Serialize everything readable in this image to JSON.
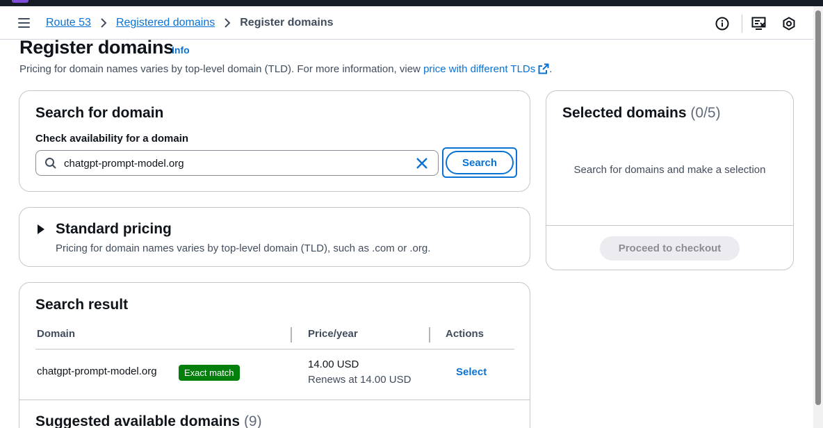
{
  "breadcrumb": {
    "items": [
      "Route 53",
      "Registered domains"
    ],
    "current": "Register domains"
  },
  "page": {
    "title": "Register domains",
    "info_label": "Info",
    "description": "Pricing for domain names varies by top-level domain (TLD). For more information, view",
    "description_link": "price with different TLDs",
    "description_end": "."
  },
  "search_card": {
    "title": "Search for domain",
    "label": "Check availability for a domain",
    "input_value": "chatgpt-prompt-model.org",
    "button_label": "Search"
  },
  "selected_card": {
    "title": "Selected domains",
    "count": "(0/5)",
    "empty_message": "Search for domains and make a selection",
    "checkout_label": "Proceed to checkout"
  },
  "pricing_card": {
    "title": "Standard pricing",
    "description": "Pricing for domain names varies by top-level domain (TLD), such as .com or .org."
  },
  "result_card": {
    "title": "Search result",
    "columns": [
      "Domain",
      "Price/year",
      "Actions"
    ],
    "rows": [
      {
        "domain": "chatgpt-prompt-model.org",
        "badge": "Exact match",
        "price": "14.00 USD",
        "renews": "Renews at 14.00 USD",
        "action": "Select"
      }
    ]
  },
  "suggested": {
    "title": "Suggested available domains",
    "count": "(9)"
  },
  "colors": {
    "link": "#0972d3",
    "badge_green": "#037f0c",
    "topbar": "#161d26"
  },
  "icons": [
    "menu-icon",
    "chevron-right-icon",
    "info-circle-icon",
    "feedback-monitor-icon",
    "cloudshell-hex-icon",
    "search-icon",
    "close-icon",
    "external-link-icon",
    "caret-right-icon"
  ]
}
